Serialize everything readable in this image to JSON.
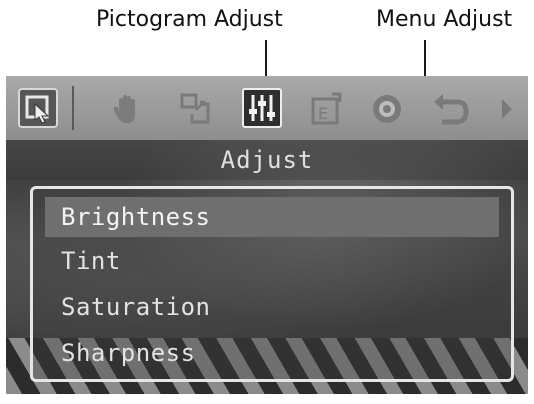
{
  "callouts": {
    "pictogram_adjust": "Pictogram Adjust",
    "menu_adjust": "Menu Adjust"
  },
  "toolbar": {
    "icons": [
      "select-icon",
      "hand-icon",
      "crop-icon",
      "adjust-sliders-icon",
      "edit-icon",
      "eye-icon",
      "undo-icon",
      "chevron-right-icon"
    ],
    "active": "adjust-sliders-icon"
  },
  "panel": {
    "title": "Adjust",
    "items": [
      {
        "label": "Brightness",
        "selected": true
      },
      {
        "label": "Tint",
        "selected": false
      },
      {
        "label": "Saturation",
        "selected": false
      },
      {
        "label": "Sharpness",
        "selected": false
      }
    ]
  },
  "colors": {
    "toolbar_bg": "#9a9a9a",
    "highlight": "#6f6f6f",
    "frame": "#e6e6e6"
  }
}
